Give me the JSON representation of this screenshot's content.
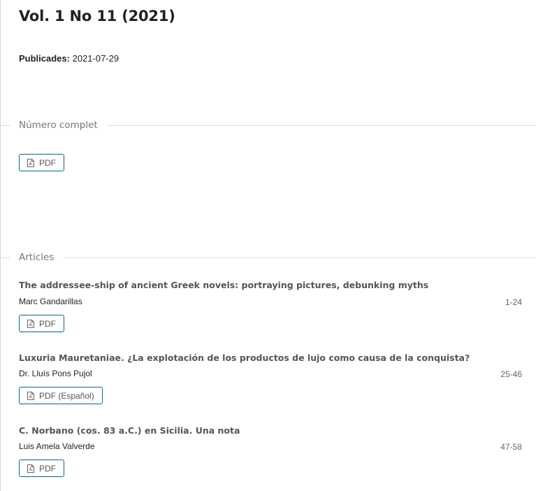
{
  "issue": {
    "title": "Vol. 1 No 11 (2021)",
    "published_label": "Publicades:",
    "published_date": "2021-07-29"
  },
  "full_issue": {
    "heading": "Número complet",
    "button_label": "PDF"
  },
  "articles_section": {
    "heading": "Articles",
    "items": [
      {
        "title": "The addressee-ship of ancient Greek novels: portraying pictures, debunking myths",
        "author": "Marc Gandarillas",
        "pages": "1-24",
        "button_label": "PDF"
      },
      {
        "title": "Luxuria Mauretaniae. ¿La explotación de los productos de lujo como causa de la conquista?",
        "author": "Dr. Lluís Pons Pujol",
        "pages": "25-46",
        "button_label": "PDF (Español)"
      },
      {
        "title": "C. Norbano (cos. 83 a.C.) en Sicilia. Una nota",
        "author": "Luis Amela Valverde",
        "pages": "47-58",
        "button_label": "PDF"
      }
    ]
  },
  "colors": {
    "accent": "#006798",
    "rule": "#dddddd"
  },
  "icons": {
    "pdf": "file-pdf-icon"
  }
}
